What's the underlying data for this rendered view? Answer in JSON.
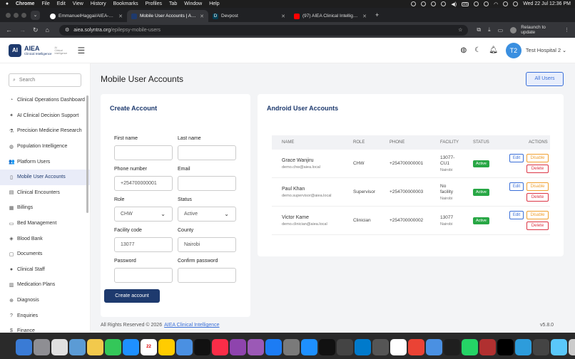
{
  "menubar": {
    "app": "Chrome",
    "items": [
      "File",
      "Edit",
      "View",
      "History",
      "Bookmarks",
      "Profiles",
      "Tab",
      "Window",
      "Help"
    ],
    "input_indicator": "US",
    "clock": "Wed 22 Jul 12:36 PM"
  },
  "tabs": [
    {
      "title": "EmmanuelHaggai/AIEA-Clinic",
      "color": "#ffffff",
      "active": false
    },
    {
      "title": "Mobile User Accounts | AIEA",
      "color": "#1e3a6e",
      "active": true
    },
    {
      "title": "Devpost",
      "color": "#003e54",
      "active": false,
      "fav_letter": "D"
    },
    {
      "title": "(97) AIEA Clinical Intelligence",
      "color": "#ff0000",
      "active": false
    }
  ],
  "toolbar": {
    "url_host": "aiea.solyntra.org",
    "url_path": "/epilepsy-mobile-users",
    "relaunch": "Relaunch to update"
  },
  "header": {
    "logo_initials": "AI",
    "logo_title": "AIEA",
    "logo_subtitle": "Clinical Intelligence",
    "logo_tagline": "AI Clinical Intelligence",
    "user_initials": "T2",
    "user_name": "Test Hospital 2"
  },
  "sidebar": {
    "search_placeholder": "Search",
    "items": [
      {
        "label": "Clinical Operations Dashboard",
        "icon": "pie-chart-icon",
        "glyph": "◔",
        "active": false
      },
      {
        "label": "AI Clinical Decision Support",
        "icon": "brain-icon",
        "glyph": "✦",
        "active": false
      },
      {
        "label": "Precision Medicine Research",
        "icon": "flask-icon",
        "glyph": "⚗",
        "active": false
      },
      {
        "label": "Population Intelligence",
        "icon": "globe-icon",
        "glyph": "◍",
        "active": false
      },
      {
        "label": "Platform Users",
        "icon": "users-icon",
        "glyph": "👥",
        "active": false
      },
      {
        "label": "Mobile User Accounts",
        "icon": "mobile-icon",
        "glyph": "▯",
        "active": true
      },
      {
        "label": "Clinical Encounters",
        "icon": "clipboard-icon",
        "glyph": "▤",
        "active": false
      },
      {
        "label": "Billings",
        "icon": "receipt-icon",
        "glyph": "▦",
        "active": false
      },
      {
        "label": "Bed Management",
        "icon": "bed-icon",
        "glyph": "▭",
        "active": false
      },
      {
        "label": "Blood Bank",
        "icon": "droplet-icon",
        "glyph": "◈",
        "active": false
      },
      {
        "label": "Documents",
        "icon": "document-icon",
        "glyph": "▢",
        "active": false
      },
      {
        "label": "Clinical Staff",
        "icon": "staff-icon",
        "glyph": "●",
        "active": false
      },
      {
        "label": "Medication Plans",
        "icon": "pill-icon",
        "glyph": "▥",
        "active": false
      },
      {
        "label": "Diagnosis",
        "icon": "diagnosis-icon",
        "glyph": "⊕",
        "active": false
      },
      {
        "label": "Enquiries",
        "icon": "question-icon",
        "glyph": "?",
        "active": false
      },
      {
        "label": "Finance",
        "icon": "finance-icon",
        "glyph": "$",
        "active": false
      }
    ]
  },
  "page": {
    "title": "Mobile User Accounts",
    "all_users": "All Users"
  },
  "create": {
    "title": "Create Account",
    "first_name_label": "First name",
    "first_name_value": "",
    "last_name_label": "Last name",
    "last_name_value": "",
    "phone_label": "Phone number",
    "phone_value": "+254700000001",
    "email_label": "Email",
    "email_value": "",
    "role_label": "Role",
    "role_value": "CHW",
    "status_label": "Status",
    "status_value": "Active",
    "facility_label": "Facility code",
    "facility_value": "13077",
    "county_label": "County",
    "county_value": "Nairobi",
    "password_label": "Password",
    "password_value": "",
    "confirm_label": "Confirm password",
    "confirm_value": "",
    "submit": "Create account"
  },
  "android": {
    "title": "Android User Accounts",
    "headers": {
      "name": "NAME",
      "role": "ROLE",
      "phone": "PHONE",
      "facility": "FACILITY",
      "status": "STATUS",
      "actions": "ACTIONS"
    },
    "rows": [
      {
        "name": "Grace Wanjiru",
        "email": "demo.chw@aiea.local",
        "role": "CHW",
        "phone": "+254700000001",
        "facility_line1": "13077-",
        "facility_line2": "CU1",
        "facility_county": "Nairobi",
        "status": "Active",
        "edit": "Edit",
        "disable": "Disable",
        "delete": "Delete"
      },
      {
        "name": "Paul Khan",
        "email": "demo.supervisor@aiea.local",
        "role": "Supervisor",
        "phone": "+254700000003",
        "facility_line1": "No",
        "facility_line2": "facility",
        "facility_county": "Nairobi",
        "status": "Active",
        "edit": "Edit",
        "disable": "Disable",
        "delete": "Delete"
      },
      {
        "name": "Victor Kame",
        "email": "demo.clinician@aiea.local",
        "role": "Clinician",
        "phone": "+254700000002",
        "facility_line1": "13077",
        "facility_line2": "",
        "facility_county": "Nairobi",
        "status": "Active",
        "edit": "Edit",
        "disable": "Disable",
        "delete": "Delete"
      }
    ]
  },
  "footer": {
    "text": "All Rights Reserved © 2026",
    "link": "AIEA Clinical Intelligence",
    "version": "v5.8.0"
  },
  "dock": {
    "calendar_day": "22",
    "colors": [
      "#3a7bd5",
      "#8e8e93",
      "#e0e0e0",
      "#5b9bd5",
      "#f2c94c",
      "#34c759",
      "#1e90ff",
      "#ffffff",
      "#ffcc00",
      "#4a90e2",
      "#111111",
      "#fa2d48",
      "#8e44ad",
      "#9b59b6",
      "#1c7cf4",
      "#7a7a7a",
      "#1e90ff",
      "#111111",
      "#444444",
      "#007acc",
      "#555555",
      "#ffffff",
      "#ea4335",
      "#4a90e2",
      "#1f1f1f",
      "#25d366",
      "#b03030",
      "#000000",
      "#2d9cdb",
      "#444444",
      "#5ac8fa",
      "#cccccc"
    ]
  }
}
